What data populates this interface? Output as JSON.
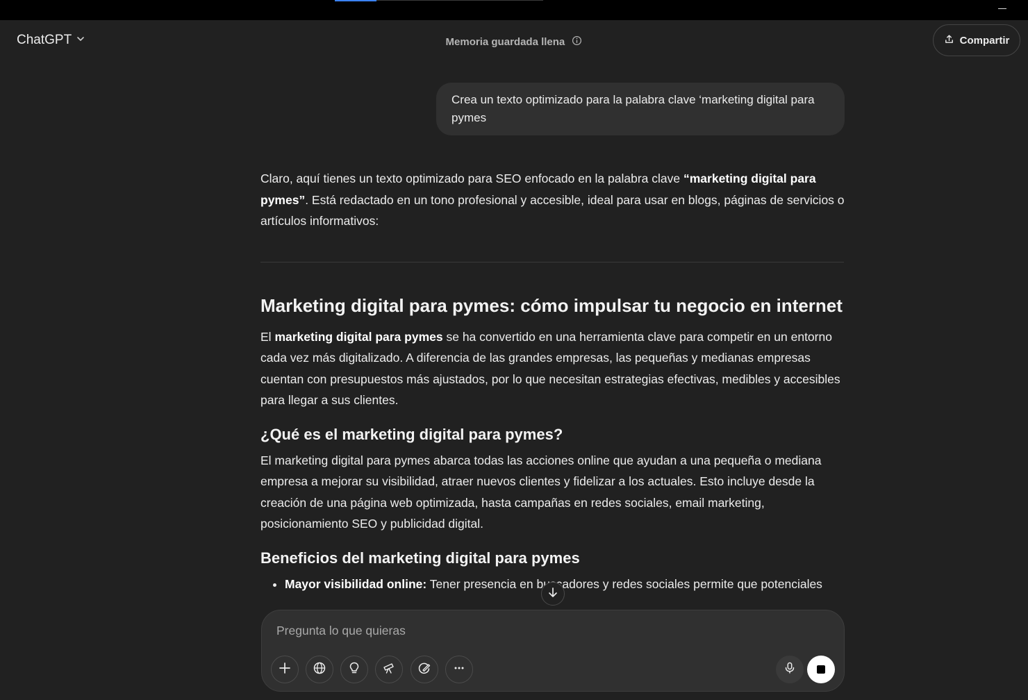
{
  "header": {
    "model_name": "ChatGPT",
    "memory_status": "Memoria guardada llena",
    "share_label": "Compartir"
  },
  "conversation": {
    "user_message": "Crea un texto optimizado para la palabra clave ‘marketing digital para pymes",
    "assistant": {
      "intro": {
        "before": "Claro, aquí tienes un texto optimizado para SEO enfocado en la palabra clave ",
        "bold": "“marketing digital para pymes”",
        "after": ". Está redactado en un tono profesional y accesible, ideal para usar en blogs, páginas de servicios o artículos informativos:"
      },
      "heading": "Marketing digital para pymes: cómo impulsar tu negocio en internet",
      "para1": {
        "before": "El ",
        "bold": "marketing digital para pymes",
        "after": " se ha convertido en una herramienta clave para competir en un entorno cada vez más digitalizado. A diferencia de las grandes empresas, las pequeñas y medianas empresas cuentan con presupuestos más ajustados, por lo que necesitan estrategias efectivas, medibles y accesibles para llegar a sus clientes."
      },
      "subheading1": "¿Qué es el marketing digital para pymes?",
      "para2": "El marketing digital para pymes abarca todas las acciones online que ayudan a una pequeña o mediana empresa a mejorar su visibilidad, atraer nuevos clientes y fidelizar a los actuales. Esto incluye desde la creación de una página web optimizada, hasta campañas en redes sociales, email marketing, posicionamiento SEO y publicidad digital.",
      "subheading2": "Beneficios del marketing digital para pymes",
      "bullets": [
        {
          "bold": "Mayor visibilidad online:",
          "text": " Tener presencia en buscadores y redes sociales permite que potenciales"
        }
      ]
    }
  },
  "composer": {
    "placeholder": "Pregunta lo que quieras"
  },
  "icons": [
    "chevron-down-icon",
    "info-icon",
    "share-icon",
    "arrow-down-icon",
    "plus-icon",
    "globe-icon",
    "lightbulb-icon",
    "telescope-icon",
    "image-brush-icon",
    "more-icon",
    "microphone-icon",
    "stop-icon"
  ]
}
